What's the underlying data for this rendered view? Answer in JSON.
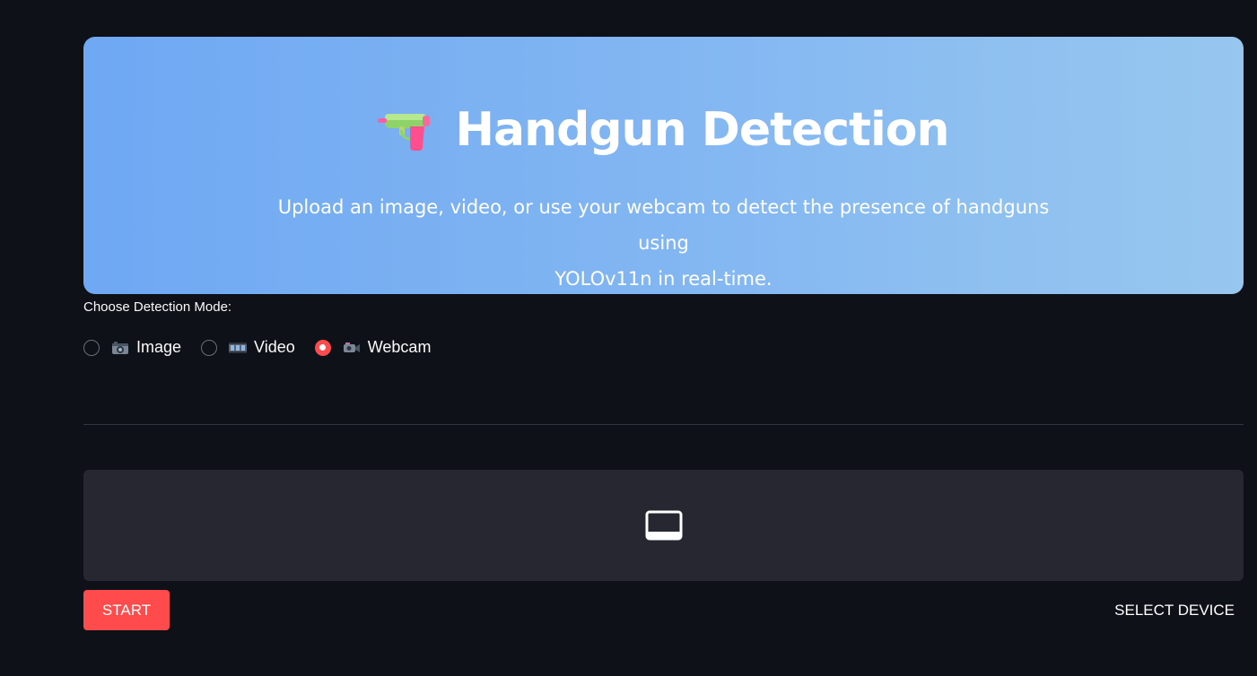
{
  "hero": {
    "icon": "water-pistol-icon",
    "title": "Handgun Detection",
    "subtitle_line1": "Upload an image, video, or use your webcam to detect the presence of handguns using",
    "subtitle_line2": "YOLOv11n in real-time.",
    "gradient_start": "#6fa8f3",
    "gradient_end": "#97c7ef"
  },
  "mode": {
    "label": "Choose Detection Mode:",
    "options": [
      {
        "label": "Image",
        "icon": "camera-icon",
        "checked": false
      },
      {
        "label": "Video",
        "icon": "film-frames-icon",
        "checked": false
      },
      {
        "label": "Webcam",
        "icon": "video-camera-icon",
        "checked": true
      }
    ],
    "accent_color": "#ff4b4b"
  },
  "webcam": {
    "placeholder_icon": "screen-icon",
    "start_label": "START",
    "select_device_label": "SELECT DEVICE"
  }
}
